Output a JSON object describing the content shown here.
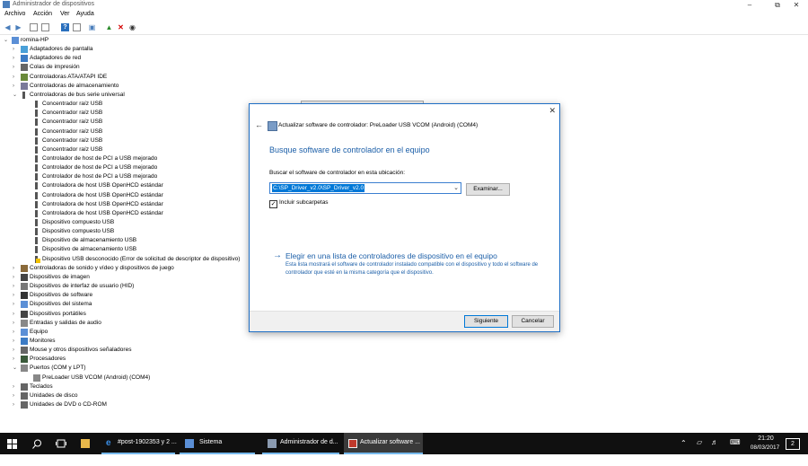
{
  "window": {
    "title": "Administrador de dispositivos"
  },
  "menu": [
    "Archivo",
    "Acción",
    "Ver",
    "Ayuda"
  ],
  "tree": [
    {
      "label": "romina-HP",
      "level": 0,
      "expanded": true,
      "icon": "computer-icon"
    },
    {
      "label": "Adaptadores de pantalla",
      "level": 1,
      "expanded": false,
      "icon": "display-adapter-icon"
    },
    {
      "label": "Adaptadores de red",
      "level": 1,
      "expanded": false,
      "icon": "network-icon"
    },
    {
      "label": "Colas de impresión",
      "level": 1,
      "expanded": false,
      "icon": "printer-icon"
    },
    {
      "label": "Controladoras ATA/ATAPI IDE",
      "level": 1,
      "expanded": false,
      "icon": "ide-icon"
    },
    {
      "label": "Controladoras de almacenamiento",
      "level": 1,
      "expanded": false,
      "icon": "storage-icon"
    },
    {
      "label": "Controladoras de bus serie universal",
      "level": 1,
      "expanded": true,
      "icon": "usb-icon"
    },
    {
      "label": "Concentrador raíz USB",
      "level": 2,
      "icon": "usb-icon"
    },
    {
      "label": "Concentrador raíz USB",
      "level": 2,
      "icon": "usb-icon"
    },
    {
      "label": "Concentrador raíz USB",
      "level": 2,
      "icon": "usb-icon"
    },
    {
      "label": "Concentrador raíz USB",
      "level": 2,
      "icon": "usb-icon"
    },
    {
      "label": "Concentrador raíz USB",
      "level": 2,
      "icon": "usb-icon"
    },
    {
      "label": "Concentrador raíz USB",
      "level": 2,
      "icon": "usb-icon"
    },
    {
      "label": "Controlador de host de PCI a USB mejorado",
      "level": 2,
      "icon": "usb-icon"
    },
    {
      "label": "Controlador de host de PCI a USB mejorado",
      "level": 2,
      "icon": "usb-icon"
    },
    {
      "label": "Controlador de host de PCI a USB mejorado",
      "level": 2,
      "icon": "usb-icon"
    },
    {
      "label": "Controladora de host USB OpenHCD estándar",
      "level": 2,
      "icon": "usb-icon"
    },
    {
      "label": "Controladora de host USB OpenHCD estándar",
      "level": 2,
      "icon": "usb-icon"
    },
    {
      "label": "Controladora de host USB OpenHCD estándar",
      "level": 2,
      "icon": "usb-icon"
    },
    {
      "label": "Controladora de host USB OpenHCD estándar",
      "level": 2,
      "icon": "usb-icon"
    },
    {
      "label": "Dispositivo compuesto USB",
      "level": 2,
      "icon": "usb-icon"
    },
    {
      "label": "Dispositivo compuesto USB",
      "level": 2,
      "icon": "usb-icon"
    },
    {
      "label": "Dispositivo de almacenamiento USB",
      "level": 2,
      "icon": "usb-icon"
    },
    {
      "label": "Dispositivo de almacenamiento USB",
      "level": 2,
      "icon": "usb-icon"
    },
    {
      "label": "Dispositivo USB desconocido (Error de solicitud de descriptor de dispositivo)",
      "level": 2,
      "icon": "warning-usb-icon"
    },
    {
      "label": "Controladoras de sonido y vídeo y dispositivos de juego",
      "level": 1,
      "expanded": false,
      "icon": "sound-icon"
    },
    {
      "label": "Dispositivos de imagen",
      "level": 1,
      "expanded": false,
      "icon": "camera-icon"
    },
    {
      "label": "Dispositivos de interfaz de usuario (HID)",
      "level": 1,
      "expanded": false,
      "icon": "hid-icon"
    },
    {
      "label": "Dispositivos de software",
      "level": 1,
      "expanded": false,
      "icon": "software-device-icon"
    },
    {
      "label": "Dispositivos del sistema",
      "level": 1,
      "expanded": false,
      "icon": "system-device-icon"
    },
    {
      "label": "Dispositivos portátiles",
      "level": 1,
      "expanded": false,
      "icon": "portable-device-icon"
    },
    {
      "label": "Entradas y salidas de audio",
      "level": 1,
      "expanded": false,
      "icon": "audio-icon"
    },
    {
      "label": "Equipo",
      "level": 1,
      "expanded": false,
      "icon": "computer-icon"
    },
    {
      "label": "Monitores",
      "level": 1,
      "expanded": false,
      "icon": "monitor-icon"
    },
    {
      "label": "Mouse y otros dispositivos señaladores",
      "level": 1,
      "expanded": false,
      "icon": "mouse-icon"
    },
    {
      "label": "Procesadores",
      "level": 1,
      "expanded": false,
      "icon": "processor-icon"
    },
    {
      "label": "Puertos (COM y LPT)",
      "level": 1,
      "expanded": true,
      "icon": "port-icon"
    },
    {
      "label": "PreLoader USB VCOM (Android) (COM4)",
      "level": 2,
      "icon": "port-icon"
    },
    {
      "label": "Teclados",
      "level": 1,
      "expanded": false,
      "icon": "keyboard-icon"
    },
    {
      "label": "Unidades de disco",
      "level": 1,
      "expanded": false,
      "icon": "disk-icon"
    },
    {
      "label": "Unidades de DVD o CD-ROM",
      "level": 1,
      "expanded": false,
      "icon": "dvd-icon"
    }
  ],
  "dialog": {
    "title": "Actualizar software de controlador: PreLoader USB VCOM (Android) (COM4)",
    "heading": "Busque software de controlador en el equipo",
    "search_label": "Buscar el software de controlador en esta ubicación:",
    "path_value": "C:\\SP_Driver_v2.0\\SP_Driver_v2.0",
    "browse_label": "Examinar...",
    "include_subfolders_label": "Incluir subcarpetas",
    "include_subfolders_checked": true,
    "link_label": "Elegir en una lista de controladores de dispositivo en el equipo",
    "link_description": "Esta lista mostrará el software de controlador instalado compatible con el dispositivo y todo el software de controlador que esté en la misma categoría que el dispositivo.",
    "next_label": "Siguiente",
    "cancel_label": "Cancelar"
  },
  "taskbar": {
    "items": [
      {
        "label": "#post-1902353 y 2 ...",
        "icon": "edge-icon",
        "active": false
      },
      {
        "label": "Sistema",
        "icon": "system-icon",
        "active": false
      },
      {
        "label": "Administrador de d...",
        "icon": "device-manager-icon",
        "active": false
      },
      {
        "label": "Actualizar software ...",
        "icon": "update-driver-icon",
        "active": true
      }
    ],
    "time": "21:20",
    "date": "08/03/2017",
    "notifications": "2"
  },
  "colors": {
    "accent": "#1c5fa8",
    "taskbar": "#101010",
    "selection": "#0078d7"
  }
}
